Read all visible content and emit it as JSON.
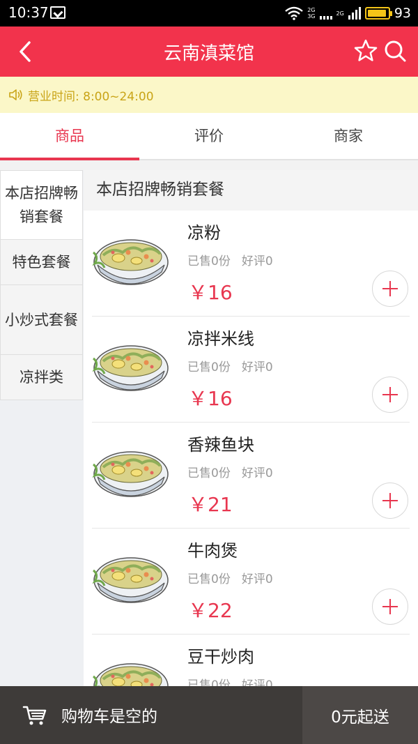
{
  "status_bar": {
    "time": "10:37",
    "network_1": "2G\n3G",
    "network_2": "2G",
    "battery_percent": "93",
    "battery_level": 0.93
  },
  "header": {
    "title": "云南滇菜馆",
    "back_icon": "chevron-left-icon",
    "favorite_icon": "star-outline-icon",
    "search_icon": "search-icon",
    "color": "#f2334c"
  },
  "notice": {
    "icon": "speaker-icon",
    "text": "营业时间: 8:00~24:00"
  },
  "tabs": [
    {
      "label": "商品",
      "active": true
    },
    {
      "label": "评价",
      "active": false
    },
    {
      "label": "商家",
      "active": false
    }
  ],
  "categories": [
    {
      "label": "本店招牌畅销套餐",
      "active": true
    },
    {
      "label": "特色套餐",
      "active": false
    },
    {
      "label": "小炒式套餐",
      "active": false
    },
    {
      "label": "凉拌类",
      "active": false
    }
  ],
  "section_title": "本店招牌畅销套餐",
  "items": [
    {
      "name": "凉粉",
      "sold": "已售0份",
      "rating": "好评0",
      "price": "￥16"
    },
    {
      "name": "凉拌米线",
      "sold": "已售0份",
      "rating": "好评0",
      "price": "￥16"
    },
    {
      "name": "香辣鱼块",
      "sold": "已售0份",
      "rating": "好评0",
      "price": "￥21"
    },
    {
      "name": "牛肉煲",
      "sold": "已售0份",
      "rating": "好评0",
      "price": "￥22"
    },
    {
      "name": "豆干炒肉",
      "sold": "已售0份",
      "rating": "好评0",
      "price": ""
    }
  ],
  "cart": {
    "icon": "cart-icon",
    "status_text": "购物车是空的",
    "min_order": "0元起送"
  },
  "colors": {
    "accent": "#e8364f",
    "notice_text": "#c9a417",
    "notice_bg": "#fbf7c8",
    "cart_bg": "#3e3b39"
  }
}
